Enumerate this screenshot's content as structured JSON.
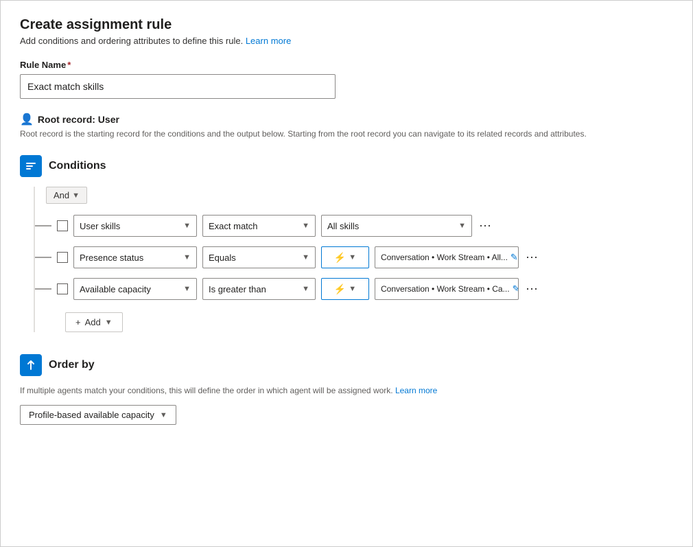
{
  "header": {
    "title": "Create assignment rule",
    "subtitle": "Add conditions and ordering attributes to define this rule.",
    "learn_more_label": "Learn more"
  },
  "rule_name": {
    "label": "Rule Name",
    "required": true,
    "value": "Exact match skills"
  },
  "root_record": {
    "label": "Root record: User",
    "description": "Root record is the starting record for the conditions and the output below. Starting from the root record you can navigate to its related records and attributes."
  },
  "conditions": {
    "title": "Conditions",
    "and_label": "And",
    "rows": [
      {
        "field": "User skills",
        "operator": "Exact match",
        "value_type": "static",
        "value": "All skills",
        "has_lightning": false
      },
      {
        "field": "Presence status",
        "operator": "Equals",
        "value_type": "dynamic",
        "value": "Conversation • Work Stream • All...",
        "has_lightning": true
      },
      {
        "field": "Available capacity",
        "operator": "Is greater than",
        "value_type": "dynamic",
        "value": "Conversation • Work Stream • Ca...",
        "has_lightning": true
      }
    ],
    "add_label": "Add"
  },
  "order_by": {
    "title": "Order by",
    "description": "If multiple agents match your conditions, this will define the order in which agent will be assigned work.",
    "learn_more_label": "Learn more",
    "value": "Profile-based available capacity"
  }
}
